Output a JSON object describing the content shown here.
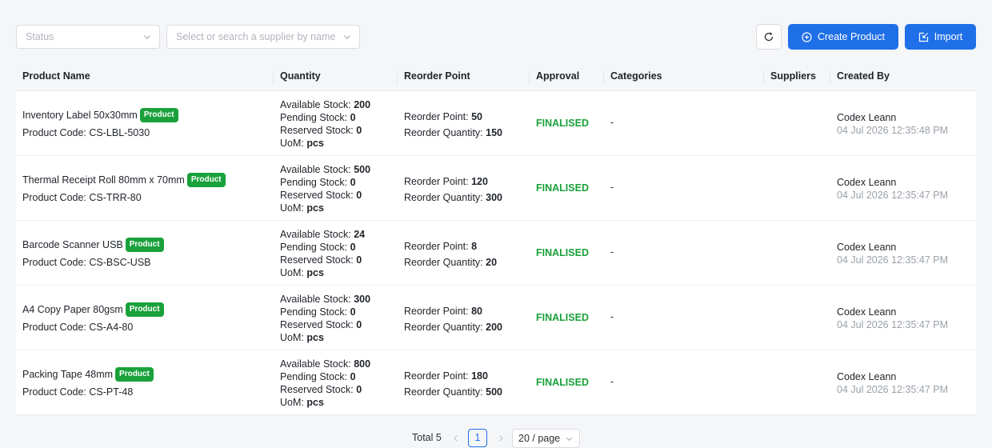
{
  "filters": {
    "status_placeholder": "Status",
    "supplier_placeholder": "Select or search a supplier by name"
  },
  "actions": {
    "create_label": "Create Product",
    "import_label": "Import"
  },
  "columns": [
    "Product Name",
    "Quantity",
    "Reorder Point",
    "Approval",
    "Categories",
    "Suppliers",
    "Created By"
  ],
  "labels": {
    "product_code": "Product Code:",
    "available": "Available Stock:",
    "pending": "Pending Stock:",
    "reserved": "Reserved Stock:",
    "uom": "UoM:",
    "reorder_point": "Reorder Point:",
    "reorder_qty": "Reorder Quantity:"
  },
  "products": [
    {
      "name": "Inventory Label 50x30mm",
      "badge": "Product",
      "code": "CS-LBL-5030",
      "available": "200",
      "pending": "0",
      "reserved": "0",
      "uom": "pcs",
      "reorder_point": "50",
      "reorder_qty": "150",
      "approval": "FINALISED",
      "categories": "-",
      "suppliers": "",
      "created_by": "Codex Leann",
      "created_at": "04 Jul 2026 12:35:48 PM"
    },
    {
      "name": "Thermal Receipt Roll 80mm x 70mm",
      "badge": "Product",
      "code": "CS-TRR-80",
      "available": "500",
      "pending": "0",
      "reserved": "0",
      "uom": "pcs",
      "reorder_point": "120",
      "reorder_qty": "300",
      "approval": "FINALISED",
      "categories": "-",
      "suppliers": "",
      "created_by": "Codex Leann",
      "created_at": "04 Jul 2026 12:35:47 PM"
    },
    {
      "name": "Barcode Scanner USB",
      "badge": "Product",
      "code": "CS-BSC-USB",
      "available": "24",
      "pending": "0",
      "reserved": "0",
      "uom": "pcs",
      "reorder_point": "8",
      "reorder_qty": "20",
      "approval": "FINALISED",
      "categories": "-",
      "suppliers": "",
      "created_by": "Codex Leann",
      "created_at": "04 Jul 2026 12:35:47 PM"
    },
    {
      "name": "A4 Copy Paper 80gsm",
      "badge": "Product",
      "code": "CS-A4-80",
      "available": "300",
      "pending": "0",
      "reserved": "0",
      "uom": "pcs",
      "reorder_point": "80",
      "reorder_qty": "200",
      "approval": "FINALISED",
      "categories": "-",
      "suppliers": "",
      "created_by": "Codex Leann",
      "created_at": "04 Jul 2026 12:35:47 PM"
    },
    {
      "name": "Packing Tape 48mm",
      "badge": "Product",
      "code": "CS-PT-48",
      "available": "800",
      "pending": "0",
      "reserved": "0",
      "uom": "pcs",
      "reorder_point": "180",
      "reorder_qty": "500",
      "approval": "FINALISED",
      "categories": "-",
      "suppliers": "",
      "created_by": "Codex Leann",
      "created_at": "04 Jul 2026 12:35:47 PM"
    }
  ],
  "pagination": {
    "total_label": "Total 5",
    "current_page": "1",
    "page_size": "20 / page"
  },
  "colors": {
    "primary": "#1f6fe8",
    "success": "#1aa13b",
    "muted": "#9aa0a8"
  }
}
